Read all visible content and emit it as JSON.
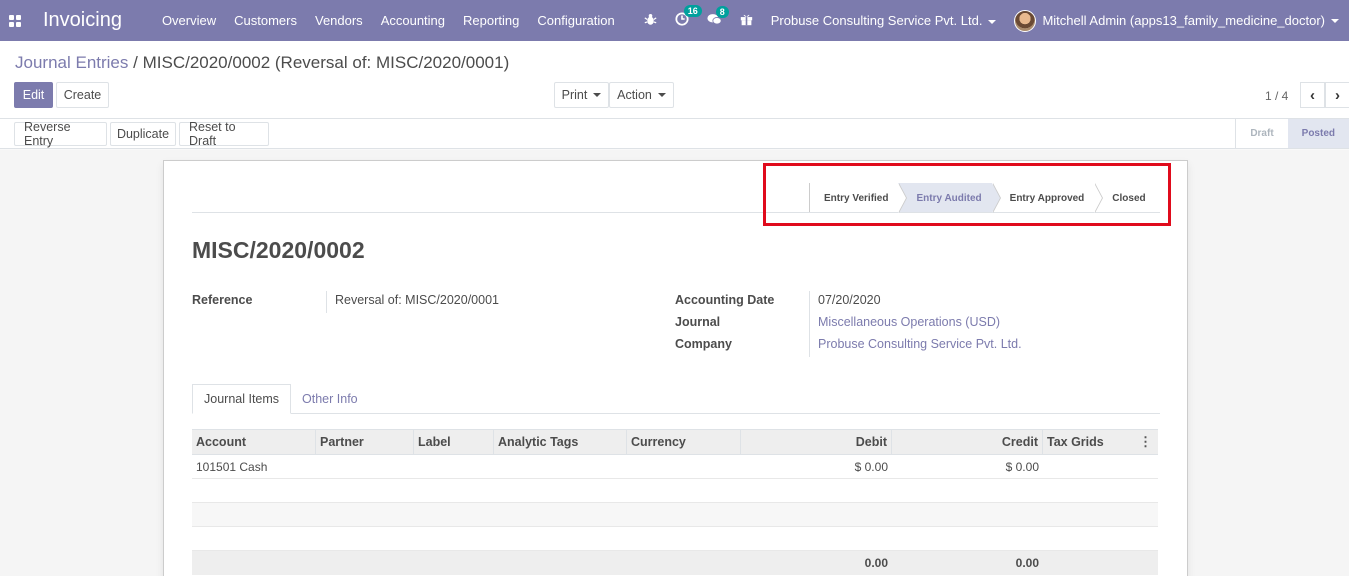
{
  "navbar": {
    "app_title": "Invoicing",
    "menu": [
      "Overview",
      "Customers",
      "Vendors",
      "Accounting",
      "Reporting",
      "Configuration"
    ],
    "activity_count": "16",
    "messages_count": "8",
    "company": "Probuse Consulting Service Pvt. Ltd.",
    "user": "Mitchell Admin (apps13_family_medicine_doctor)",
    "accent_color": "#7c7bad"
  },
  "breadcrumb": {
    "parent": "Journal Entries",
    "separator": "/",
    "current": "MISC/2020/0002 (Reversal of: MISC/2020/0001)"
  },
  "buttons": {
    "edit": "Edit",
    "create": "Create",
    "print": "Print",
    "action": "Action",
    "reverse_entry": "Reverse Entry",
    "duplicate": "Duplicate",
    "reset_to_draft": "Reset to Draft"
  },
  "pager": {
    "value": "1 / 4",
    "prev_icon": "chevron-left",
    "next_icon": "chevron-right"
  },
  "statusbar": {
    "draft": "Draft",
    "posted": "Posted",
    "active": "Posted"
  },
  "stages": {
    "entry_verified": "Entry Verified",
    "entry_audited": "Entry Audited",
    "entry_approved": "Entry Approved",
    "closed": "Closed",
    "active": "Entry Audited",
    "highlight_color": "#e00b1c"
  },
  "record": {
    "title": "MISC/2020/0002",
    "reference_label": "Reference",
    "reference_value": "Reversal of: MISC/2020/0001",
    "accounting_date_label": "Accounting Date",
    "accounting_date_value": "07/20/2020",
    "journal_label": "Journal",
    "journal_value": "Miscellaneous Operations (USD)",
    "company_label": "Company",
    "company_value": "Probuse Consulting Service Pvt. Ltd."
  },
  "tabs": {
    "journal_items": "Journal Items",
    "other_info": "Other Info",
    "active": "Journal Items"
  },
  "table": {
    "headers": {
      "account": "Account",
      "partner": "Partner",
      "label": "Label",
      "analytic_tags": "Analytic Tags",
      "currency": "Currency",
      "debit": "Debit",
      "credit": "Credit",
      "tax_grids": "Tax Grids"
    },
    "rows": [
      {
        "account": "101501 Cash",
        "partner": "",
        "label": "",
        "analytic_tags": "",
        "currency": "",
        "debit": "$ 0.00",
        "credit": "$ 0.00",
        "tax_grids": ""
      }
    ],
    "totals": {
      "debit": "0.00",
      "credit": "0.00"
    }
  }
}
